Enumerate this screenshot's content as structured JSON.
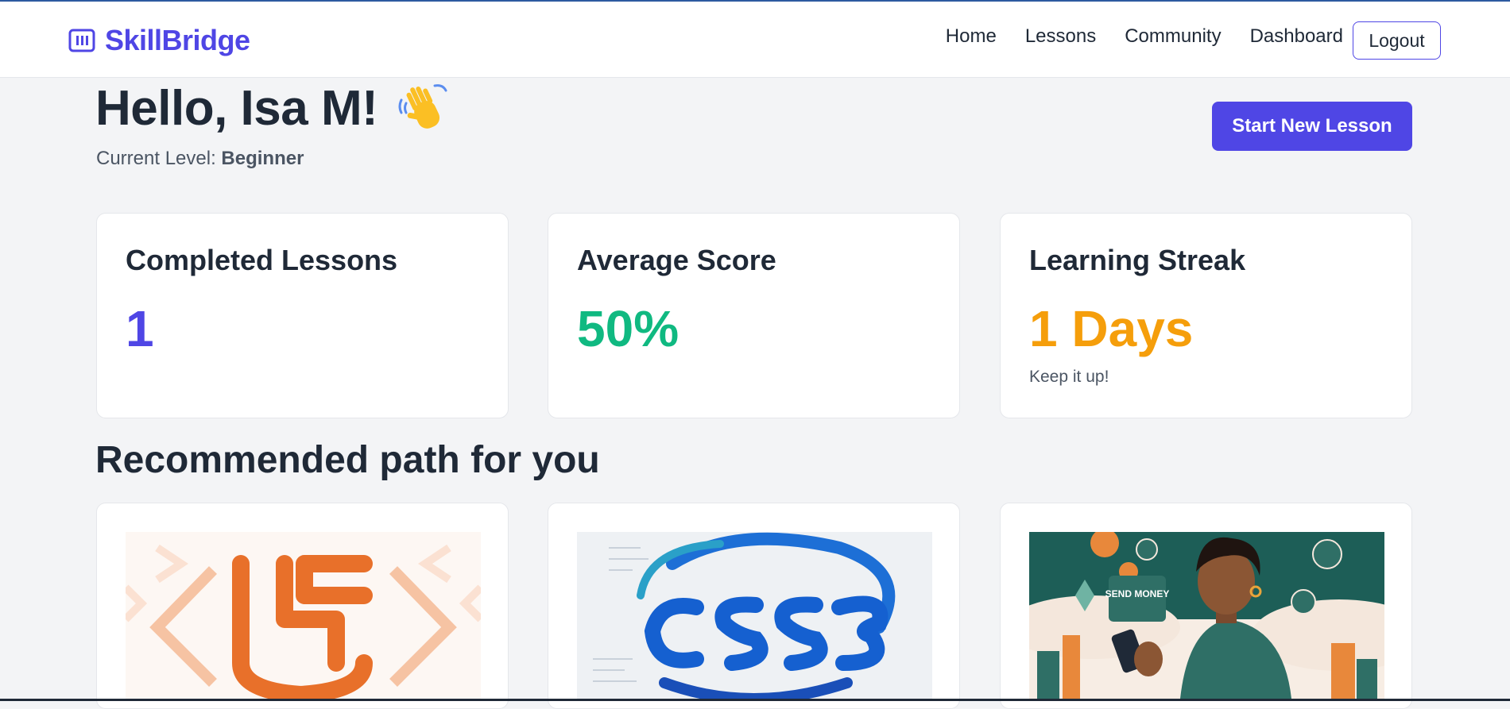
{
  "app": {
    "name": "SkillBridge"
  },
  "nav": {
    "items": [
      "Home",
      "Lessons",
      "Community",
      "Dashboard"
    ],
    "logout_label": "Logout"
  },
  "greeting": {
    "text": "Hello, Isa M!",
    "emoji_icon": "waving-hand-icon"
  },
  "level": {
    "label": "Current Level: ",
    "value": "Beginner"
  },
  "actions": {
    "start_lesson_label": "Start New Lesson"
  },
  "stats": [
    {
      "title": "Completed Lessons",
      "value": "1",
      "color": "#4f46e5"
    },
    {
      "title": "Average Score",
      "value": "50%",
      "color": "#10b981"
    },
    {
      "title": "Learning Streak",
      "value": "1 Days",
      "subtitle": "Keep it up!",
      "color": "#f59e0b"
    }
  ],
  "recommended": {
    "title": "Recommended path for you",
    "courses": [
      {
        "image_icon": "html5-illustration",
        "image_text": ""
      },
      {
        "image_icon": "css3-illustration",
        "image_text": ""
      },
      {
        "image_icon": "send-money-illustration",
        "image_text": "SEND MONEY"
      }
    ]
  },
  "colors": {
    "brand": "#4f46e5",
    "background": "#f3f4f6"
  }
}
